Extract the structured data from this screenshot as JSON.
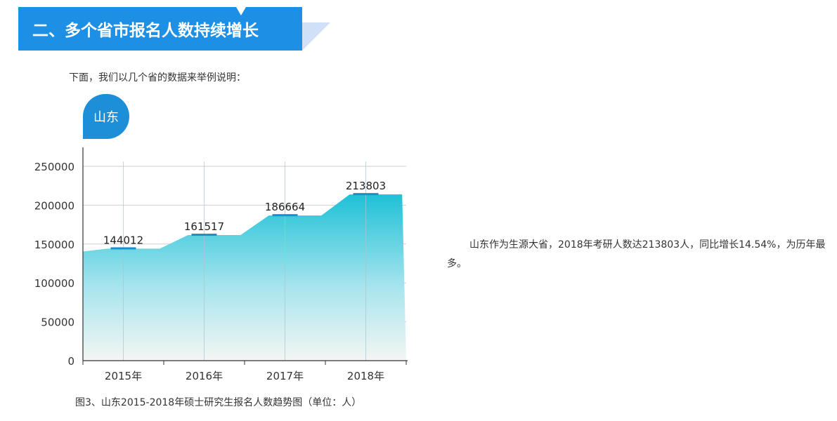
{
  "section": {
    "title": "二、多个省市报名人数持续增长"
  },
  "intro_text": "下面，我们以几个省的数据来举例说明：",
  "province_tag": "山东",
  "description": "山东作为生源大省，2018年考研人数达213803人，同比增长14.54%，为历年最多。",
  "caption": "图3、山东2015-2018年硕士研究生报名人数趋势图（单位：人）",
  "colors": {
    "banner": "#1d90e5",
    "tag": "#1d8fd9",
    "area_top": "#1fc0d6",
    "area_bottom": "#f4f6f3",
    "marker": "#1a8fd0"
  },
  "chart_data": {
    "type": "area",
    "categories": [
      "2015年",
      "2016年",
      "2017年",
      "2018年"
    ],
    "values": [
      144012,
      161517,
      186664,
      213803
    ],
    "data_labels": [
      "144012",
      "161517",
      "186664",
      "213803"
    ],
    "ylim": [
      0,
      250000
    ],
    "yticks": [
      "0",
      "50000",
      "100000",
      "150000",
      "200000",
      "250000"
    ],
    "grid": true,
    "title": "",
    "xlabel": "",
    "ylabel": ""
  }
}
